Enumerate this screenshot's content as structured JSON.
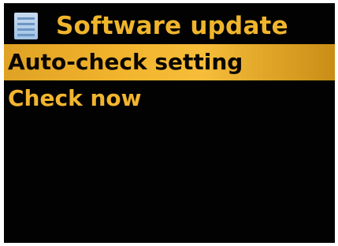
{
  "header": {
    "title": "Software update",
    "icon": "menu-list-icon"
  },
  "menu": {
    "items": [
      {
        "label": "Auto-check setting",
        "selected": true
      },
      {
        "label": "Check now",
        "selected": false
      }
    ]
  },
  "colors": {
    "background": "#020202",
    "accent": "#f2b52e",
    "selected_text": "#0a0703",
    "icon": "#9fc3e6"
  }
}
